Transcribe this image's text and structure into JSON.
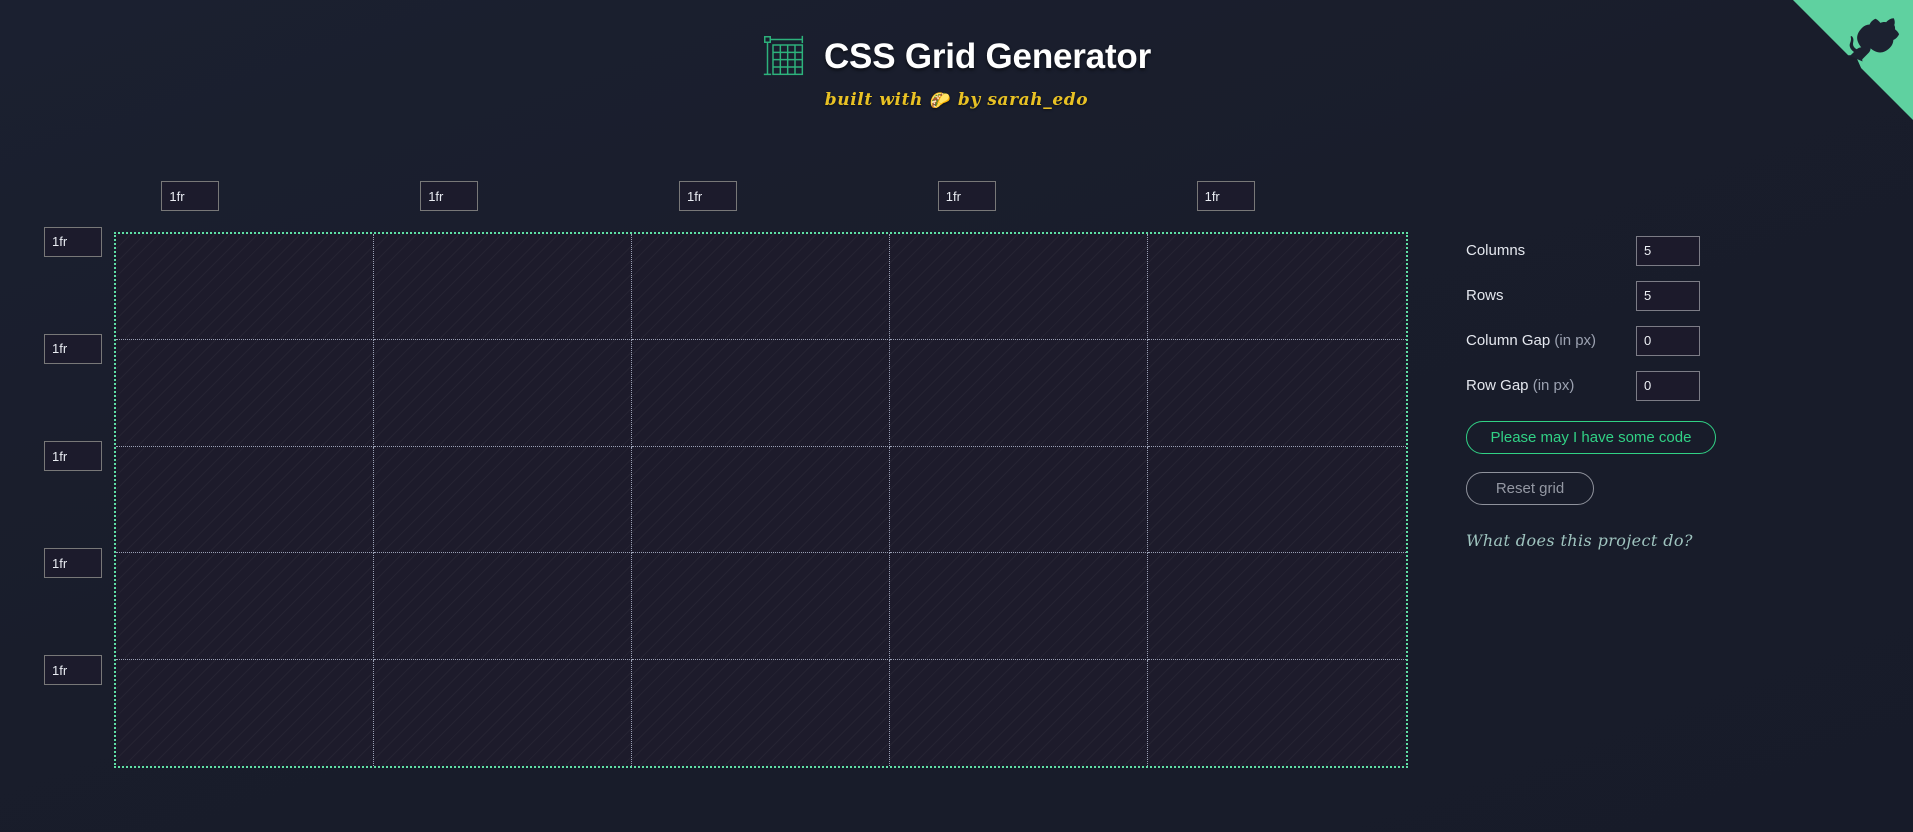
{
  "header": {
    "title": "CSS Grid Generator",
    "subtitle_before": "built with ",
    "subtitle_emoji": "🌮",
    "subtitle_after": " by sarah_edo",
    "grid_icon_name": "grid-measure-icon"
  },
  "github_corner": {
    "label": "View source on GitHub",
    "ribbon_color": "#5fd1a0",
    "octocat_color": "#1c2130"
  },
  "grid": {
    "columns": 5,
    "rows": 5,
    "column_sizes": [
      "1fr",
      "1fr",
      "1fr",
      "1fr",
      "1fr"
    ],
    "row_sizes": [
      "1fr",
      "1fr",
      "1fr",
      "1fr",
      "1fr"
    ],
    "border_color": "#5fdfa4",
    "divider_color": "#9aa0b4",
    "cell_count": 25
  },
  "controls": {
    "rows": [
      {
        "label": "Columns",
        "unit": "",
        "value": "5",
        "name": "columns"
      },
      {
        "label": "Rows",
        "unit": "",
        "value": "5",
        "name": "rows"
      },
      {
        "label": "Column Gap ",
        "unit": "(in px)",
        "value": "0",
        "name": "column-gap"
      },
      {
        "label": "Row Gap ",
        "unit": "(in px)",
        "value": "0",
        "name": "row-gap"
      }
    ],
    "code_button": "Please may I have some code",
    "reset_button": "Reset grid",
    "explain_link": "What does this project do?",
    "accent_color": "#31d185"
  },
  "theme": {
    "background": "#191d2b",
    "cell_background": "#1d1b2b",
    "text": "#e8eaf0",
    "subtitle_color": "#e8c124"
  }
}
